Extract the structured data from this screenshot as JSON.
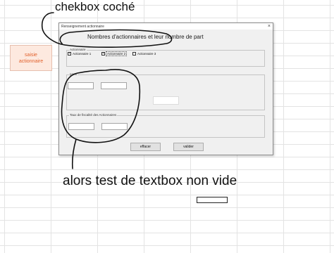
{
  "annotations": {
    "top": "chekbox coché",
    "bottom": "alors test de textbox non vide"
  },
  "sheet": {
    "button_label": "saisie\nactionnaire"
  },
  "dialog": {
    "title": "Renseignement actionnaire",
    "close_glyph": "×",
    "heading": "Nombres d'actionnaires et leur nombre de part",
    "frames": {
      "actionnaire": "Actionnaire",
      "parts": "parts",
      "taux": "Taux de fiscalité des Actionnaires"
    },
    "checkboxes": [
      {
        "label": "Actionnaire 1",
        "checked": true,
        "mark": "✓"
      },
      {
        "label": "Actionnaire 2",
        "checked": true,
        "mark": "✓"
      },
      {
        "label": "Actionnaire 3",
        "checked": false,
        "mark": ""
      }
    ],
    "buttons": {
      "effacer": "effacer",
      "valider": "valider"
    }
  },
  "colors": {
    "sheet_button_bg": "#fde9df",
    "sheet_button_text": "#e2612c",
    "dialog_bg": "#f0f0f0"
  }
}
